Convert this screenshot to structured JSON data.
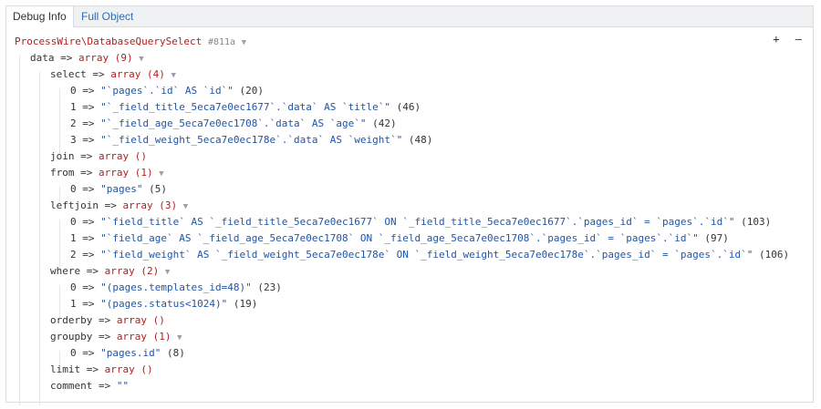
{
  "tabs": {
    "debug_info": "Debug Info",
    "full_object": "Full Object"
  },
  "tools": {
    "expand": "+",
    "collapse": "–"
  },
  "dump": {
    "class_name": "ProcessWire\\DatabaseQuerySelect",
    "object_id": "#811a",
    "toggle": "▼",
    "arrow": "=>",
    "rows": [
      {
        "key": "data",
        "type": "array (9)"
      },
      {
        "key": "select",
        "type": "array (4)"
      },
      {
        "key": "0",
        "value": "\"`pages`.`id` AS `id`\"",
        "len": "(20)"
      },
      {
        "key": "1",
        "value": "\"`_field_title_5eca7e0ec1677`.`data` AS `title`\"",
        "len": "(46)"
      },
      {
        "key": "2",
        "value": "\"`_field_age_5eca7e0ec1708`.`data` AS `age`\"",
        "len": "(42)"
      },
      {
        "key": "3",
        "value": "\"`_field_weight_5eca7e0ec178e`.`data` AS `weight`\"",
        "len": "(48)"
      },
      {
        "key": "join",
        "type": "array ()"
      },
      {
        "key": "from",
        "type": "array (1)"
      },
      {
        "key": "0",
        "value": "\"pages\"",
        "len": "(5)"
      },
      {
        "key": "leftjoin",
        "type": "array (3)"
      },
      {
        "key": "0",
        "value": "\"`field_title` AS `_field_title_5eca7e0ec1677` ON `_field_title_5eca7e0ec1677`.`pages_id` = `pages`.`id`\"",
        "len": "(103)"
      },
      {
        "key": "1",
        "value": "\"`field_age` AS `_field_age_5eca7e0ec1708` ON `_field_age_5eca7e0ec1708`.`pages_id` = `pages`.`id`\"",
        "len": "(97)"
      },
      {
        "key": "2",
        "value": "\"`field_weight` AS `_field_weight_5eca7e0ec178e` ON `_field_weight_5eca7e0ec178e`.`pages_id` = `pages`.`id`\"",
        "len": "(106)"
      },
      {
        "key": "where",
        "type": "array (2)"
      },
      {
        "key": "0",
        "value": "\"(pages.templates_id=48)\"",
        "len": "(23)"
      },
      {
        "key": "1",
        "value": "\"(pages.status<1024)\"",
        "len": "(19)"
      },
      {
        "key": "orderby",
        "type": "array ()"
      },
      {
        "key": "groupby",
        "type": "array (1)"
      },
      {
        "key": "0",
        "value": "\"pages.id\"",
        "len": "(8)"
      },
      {
        "key": "limit",
        "type": "array ()"
      },
      {
        "key": "comment",
        "value": "\"\""
      }
    ]
  },
  "colors": {
    "array": "#b41e1e",
    "string": "#2055a8",
    "class": "#b41e1e"
  }
}
